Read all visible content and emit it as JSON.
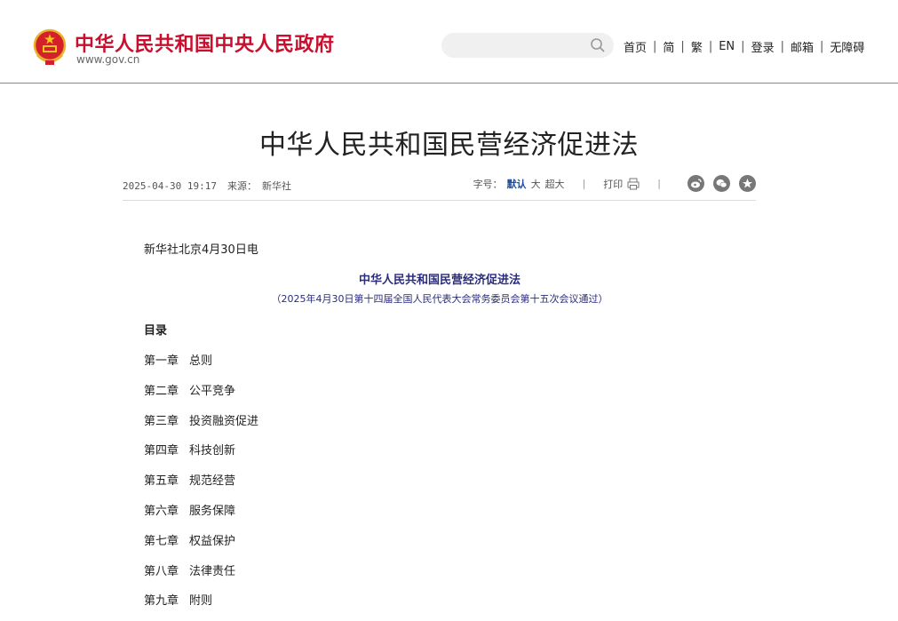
{
  "header": {
    "site_title": "中华人民共和国中央人民政府",
    "site_domain": "www.gov.cn",
    "search": {
      "placeholder": "",
      "value": ""
    },
    "nav": [
      "首页",
      "简",
      "繁",
      "EN",
      "登录",
      "邮箱",
      "无障碍"
    ]
  },
  "article": {
    "title": "中华人民共和国民营经济促进法",
    "date": "2025-04-30 19:17",
    "source_label": "来源：",
    "source": "新华社",
    "font_size_label": "字号：",
    "font_sizes": [
      "默认",
      "大",
      "超大"
    ],
    "print_label": "打印",
    "share_icons": [
      "weibo-icon",
      "wechat-icon",
      "favorite-icon"
    ]
  },
  "content": {
    "dateline": "新华社北京4月30日电",
    "law_title": "中华人民共和国民营经济促进法",
    "law_subtitle": "（2025年4月30日第十四届全国人民代表大会常务委员会第十五次会议通过）",
    "toc_heading": "目录",
    "toc": [
      {
        "num": "第一章",
        "title": "总则"
      },
      {
        "num": "第二章",
        "title": "公平竞争"
      },
      {
        "num": "第三章",
        "title": "投资融资促进"
      },
      {
        "num": "第四章",
        "title": "科技创新"
      },
      {
        "num": "第五章",
        "title": "规范经营"
      },
      {
        "num": "第六章",
        "title": "服务保障"
      },
      {
        "num": "第七章",
        "title": "权益保护"
      },
      {
        "num": "第八章",
        "title": "法律责任"
      },
      {
        "num": "第九章",
        "title": "附则"
      }
    ]
  },
  "colors": {
    "brand_red": "#c8102e",
    "law_blue": "#2b2c7c",
    "active_blue": "#1d4e9e"
  }
}
